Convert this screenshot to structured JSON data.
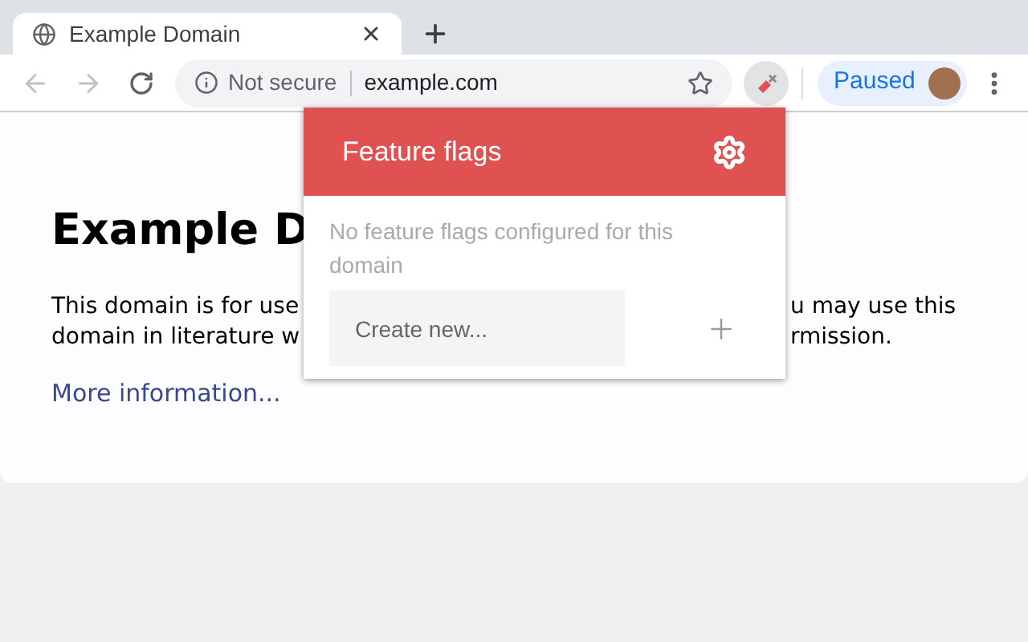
{
  "tab": {
    "title": "Example Domain",
    "selected": true
  },
  "address": {
    "security": "Not secure",
    "url": "example.com"
  },
  "profile": {
    "label": "Paused"
  },
  "page": {
    "heading": "Example D",
    "lines": [
      {
        "left": "This domain is for use",
        "right": "u may use this"
      },
      {
        "left": "domain in literature w",
        "right": "rmission."
      }
    ],
    "link": "More information..."
  },
  "popup": {
    "title": "Feature flags",
    "message": "No feature flags configured for this domain",
    "input": {
      "placeholder": "Create new..."
    }
  }
}
